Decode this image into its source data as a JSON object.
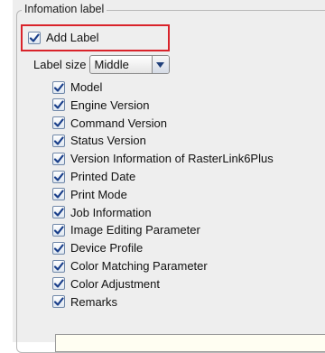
{
  "group": {
    "title": "Infomation label"
  },
  "add_label": {
    "label": "Add Label",
    "checked": true
  },
  "label_size": {
    "label": "Label size",
    "selected": "Middle"
  },
  "items": [
    {
      "label": "Model",
      "checked": true
    },
    {
      "label": "Engine Version",
      "checked": true
    },
    {
      "label": "Command Version",
      "checked": true
    },
    {
      "label": "Status Version",
      "checked": true
    },
    {
      "label": "Version Information of RasterLink6Plus",
      "checked": true
    },
    {
      "label": "Printed Date",
      "checked": true
    },
    {
      "label": "Print Mode",
      "checked": true
    },
    {
      "label": "Job Information",
      "checked": true
    },
    {
      "label": "Image Editing Parameter",
      "checked": true
    },
    {
      "label": "Device Profile",
      "checked": true
    },
    {
      "label": "Color Matching Parameter",
      "checked": true
    },
    {
      "label": "Color Adjustment",
      "checked": true
    },
    {
      "label": "Remarks",
      "checked": true
    }
  ],
  "colors": {
    "highlight": "#d9232a",
    "check": "#1a3f8a"
  }
}
